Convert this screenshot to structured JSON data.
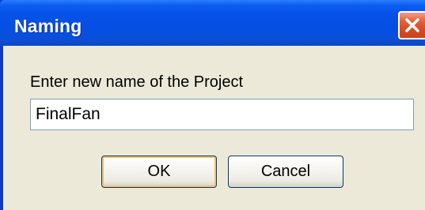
{
  "window": {
    "title": "Naming",
    "close_icon": "close-icon"
  },
  "form": {
    "prompt": "Enter new name of the Project",
    "name_value": "FinalFan"
  },
  "buttons": {
    "ok_label": "OK",
    "cancel_label": "Cancel"
  },
  "colors": {
    "titlebar": "#0450e4",
    "close_button": "#d44a24",
    "dialog_face": "#ece9d8",
    "default_button_focus": "#f4c06a"
  }
}
